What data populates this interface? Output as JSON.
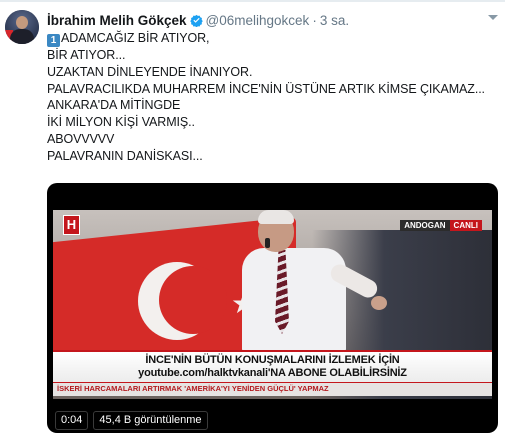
{
  "author": {
    "name": "İbrahim Melih Gökçek",
    "handle": "@06melihgokcek",
    "separator": "·",
    "time": "3 sa."
  },
  "tweet": {
    "keycap": "1",
    "lines": [
      "ADAMCAĞIZ BİR ATIYOR,",
      "BİR ATIYOR...",
      "UZAKTAN DİNLEYENDE İNANIYOR.",
      "PALAVRACILIKDA MUHARREM İNCE'NİN ÜSTÜNE ARTIK KİMSE ÇIKAMAZ...",
      "ANKARA'DA MİTİNGDE",
      "İKİ MİLYON KİŞİ VARMIŞ..",
      "ABOVVVVV",
      "PALAVRANIN DANİSKASI..."
    ]
  },
  "video": {
    "channel_logo": "H",
    "broadcast_source": "ANDOGAN",
    "live_label": "CANLI",
    "banner_line1": "İNCE'NİN BÜTÜN KONUŞMALARINI İZLEMEK İÇİN",
    "banner_line2": "youtube.com/halktvkanali'NA ABONE OLABİLİRSİNİZ",
    "ticker": "İSKERİ HARCAMALARI ARTIRMAK 'AMERİKA'YI YENİDEN GÜÇLÜ' YAPMAZ",
    "timestamp": "0:04",
    "views": "45,4 B görüntülenme"
  },
  "icons": {
    "verified": "verified-badge-icon",
    "menu": "chevron-down-icon"
  },
  "colors": {
    "verified_blue": "#1da1f2",
    "keycap_blue": "#3b88c3",
    "channel_red": "#c4161c"
  }
}
